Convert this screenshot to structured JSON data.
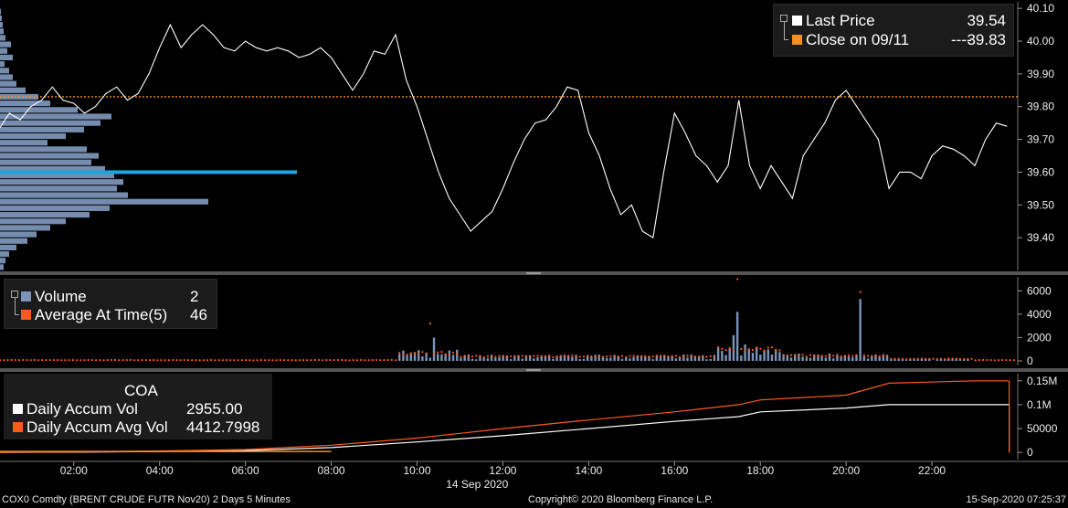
{
  "chart_data": [
    {
      "type": "line",
      "panel": "price",
      "series": [
        {
          "name": "Last Price",
          "color": "#ffffff",
          "values": [
            [
              0.0,
              39.62
            ],
            [
              0.25,
              39.73
            ],
            [
              0.5,
              39.78
            ],
            [
              0.75,
              39.76
            ],
            [
              1.0,
              39.8
            ],
            [
              1.25,
              39.82
            ],
            [
              1.5,
              39.86
            ],
            [
              1.75,
              39.82
            ],
            [
              2.0,
              39.81
            ],
            [
              2.25,
              39.78
            ],
            [
              2.5,
              39.8
            ],
            [
              2.75,
              39.84
            ],
            [
              3.0,
              39.86
            ],
            [
              3.25,
              39.82
            ],
            [
              3.5,
              39.84
            ],
            [
              3.75,
              39.9
            ],
            [
              4.0,
              39.98
            ],
            [
              4.25,
              40.05
            ],
            [
              4.5,
              39.98
            ],
            [
              4.75,
              40.02
            ],
            [
              5.0,
              40.05
            ],
            [
              5.25,
              40.02
            ],
            [
              5.5,
              39.98
            ],
            [
              5.75,
              39.97
            ],
            [
              6.0,
              40.0
            ],
            [
              6.25,
              39.98
            ],
            [
              6.5,
              39.97
            ],
            [
              6.75,
              39.98
            ],
            [
              7.0,
              39.97
            ],
            [
              7.25,
              39.95
            ],
            [
              7.5,
              39.96
            ],
            [
              7.75,
              39.98
            ],
            [
              8.0,
              39.95
            ],
            [
              8.25,
              39.9
            ],
            [
              8.5,
              39.85
            ],
            [
              8.75,
              39.9
            ],
            [
              9.0,
              39.97
            ],
            [
              9.25,
              39.96
            ],
            [
              9.5,
              40.02
            ],
            [
              9.75,
              39.88
            ],
            [
              10.0,
              39.8
            ],
            [
              10.25,
              39.7
            ],
            [
              10.5,
              39.6
            ],
            [
              10.75,
              39.52
            ],
            [
              11.0,
              39.47
            ],
            [
              11.25,
              39.42
            ],
            [
              11.5,
              39.45
            ],
            [
              11.75,
              39.48
            ],
            [
              12.0,
              39.55
            ],
            [
              12.25,
              39.63
            ],
            [
              12.5,
              39.7
            ],
            [
              12.75,
              39.75
            ],
            [
              13.0,
              39.76
            ],
            [
              13.25,
              39.8
            ],
            [
              13.5,
              39.86
            ],
            [
              13.75,
              39.85
            ],
            [
              14.0,
              39.72
            ],
            [
              14.25,
              39.65
            ],
            [
              14.5,
              39.55
            ],
            [
              14.75,
              39.47
            ],
            [
              15.0,
              39.5
            ],
            [
              15.25,
              39.42
            ],
            [
              15.5,
              39.4
            ],
            [
              15.75,
              39.6
            ],
            [
              16.0,
              39.78
            ],
            [
              16.25,
              39.72
            ],
            [
              16.5,
              39.65
            ],
            [
              16.75,
              39.62
            ],
            [
              17.0,
              39.57
            ],
            [
              17.25,
              39.62
            ],
            [
              17.5,
              39.82
            ],
            [
              17.75,
              39.62
            ],
            [
              18.0,
              39.55
            ],
            [
              18.25,
              39.62
            ],
            [
              18.5,
              39.57
            ],
            [
              18.75,
              39.52
            ],
            [
              19.0,
              39.65
            ],
            [
              19.25,
              39.7
            ],
            [
              19.5,
              39.75
            ],
            [
              19.75,
              39.82
            ],
            [
              20.0,
              39.85
            ],
            [
              20.25,
              39.8
            ],
            [
              20.5,
              39.75
            ],
            [
              20.75,
              39.7
            ],
            [
              21.0,
              39.55
            ],
            [
              21.25,
              39.6
            ],
            [
              21.5,
              39.6
            ],
            [
              21.75,
              39.58
            ],
            [
              22.0,
              39.65
            ],
            [
              22.25,
              39.68
            ],
            [
              22.5,
              39.67
            ],
            [
              22.75,
              39.65
            ],
            [
              23.0,
              39.62
            ],
            [
              23.25,
              39.7
            ],
            [
              23.5,
              39.75
            ],
            [
              23.75,
              39.74
            ]
          ]
        },
        {
          "name": "Close on 09/11",
          "color": "#f5911e",
          "constant": 39.83
        }
      ],
      "volume_profile": [
        [
          40.09,
          1
        ],
        [
          40.07,
          2
        ],
        [
          40.05,
          3
        ],
        [
          40.03,
          4
        ],
        [
          40.01,
          6
        ],
        [
          39.99,
          12
        ],
        [
          39.97,
          8
        ],
        [
          39.95,
          14
        ],
        [
          39.93,
          5
        ],
        [
          39.91,
          10
        ],
        [
          39.89,
          14
        ],
        [
          39.87,
          18
        ],
        [
          39.85,
          28
        ],
        [
          39.83,
          42
        ],
        [
          39.81,
          55
        ],
        [
          39.79,
          85
        ],
        [
          39.77,
          122
        ],
        [
          39.75,
          110
        ],
        [
          39.73,
          92
        ],
        [
          39.71,
          72
        ],
        [
          39.69,
          52
        ],
        [
          39.67,
          95
        ],
        [
          39.65,
          108
        ],
        [
          39.63,
          100
        ],
        [
          39.61,
          115
        ],
        [
          39.59,
          125
        ],
        [
          39.57,
          135
        ],
        [
          39.55,
          128
        ],
        [
          39.53,
          140
        ],
        [
          39.51,
          228
        ],
        [
          39.49,
          120
        ],
        [
          39.47,
          98
        ],
        [
          39.45,
          72
        ],
        [
          39.43,
          55
        ],
        [
          39.41,
          40
        ],
        [
          39.39,
          30
        ],
        [
          39.37,
          18
        ],
        [
          39.35,
          10
        ],
        [
          39.33,
          6
        ],
        [
          39.31,
          4
        ]
      ],
      "profile_max_level": 39.6,
      "ylim": [
        39.3,
        40.12
      ],
      "yticks": [
        "39.40",
        "39.50",
        "39.60",
        "39.70",
        "39.80",
        "39.90",
        "40.00",
        "40.10"
      ]
    },
    {
      "type": "bar",
      "panel": "volume",
      "series": [
        {
          "name": "Volume",
          "color": "#7b94b8"
        },
        {
          "name": "Average At Time(5)",
          "color": "#ff5a1e"
        }
      ],
      "ylim": [
        0,
        7200
      ],
      "yticks": [
        "0",
        "2000",
        "4000",
        "6000"
      ]
    },
    {
      "type": "line",
      "panel": "accumulated volume",
      "title": "COA",
      "series": [
        {
          "name": "Daily Accum Vol",
          "color": "#ffffff",
          "values": [
            [
              0,
              0
            ],
            [
              2,
              500
            ],
            [
              4,
              2000
            ],
            [
              6,
              4000
            ],
            [
              8,
              10000
            ],
            [
              10,
              22000
            ],
            [
              12,
              35000
            ],
            [
              14,
              50000
            ],
            [
              16,
              65000
            ],
            [
              17.5,
              75000
            ],
            [
              18,
              85000
            ],
            [
              20,
              93000
            ],
            [
              21,
              100000
            ],
            [
              23,
              100000
            ],
            [
              23.8,
              100000
            ]
          ]
        },
        {
          "name": "Daily Accum Avg Vol",
          "color": "#ff5a1e",
          "values": [
            [
              0,
              0
            ],
            [
              2,
              1000
            ],
            [
              4,
              3000
            ],
            [
              6,
              6000
            ],
            [
              8,
              15000
            ],
            [
              10,
              30000
            ],
            [
              12,
              50000
            ],
            [
              14,
              68000
            ],
            [
              16,
              85000
            ],
            [
              17.5,
              100000
            ],
            [
              18,
              110000
            ],
            [
              20,
              120000
            ],
            [
              21,
              145000
            ],
            [
              23,
              150000
            ],
            [
              23.8,
              150000
            ]
          ]
        }
      ],
      "ylim": [
        -15000,
        165000
      ],
      "yticks": [
        "0",
        "50000",
        "0.1M",
        "0.15M"
      ]
    }
  ],
  "x_axis": {
    "ticks": [
      "02:00",
      "04:00",
      "06:00",
      "08:00",
      "10:00",
      "12:00",
      "14:00",
      "16:00",
      "18:00",
      "20:00",
      "22:00"
    ],
    "date_label": "14 Sep 2020"
  },
  "legend_price": {
    "last_price_label": "Last Price",
    "last_price_value": "39.54",
    "close_label": "Close on 09/11",
    "close_dashes": "----",
    "close_value": "39.83"
  },
  "legend_volume": {
    "volume_label": "Volume",
    "volume_value": "2",
    "avg_label": "Average At Time(5)",
    "avg_value": "46"
  },
  "legend_accum": {
    "title": "COA",
    "accum_label": "Daily Accum Vol",
    "accum_value": "2955.00",
    "avg_label": "Daily Accum Avg Vol",
    "avg_value": "4412.7998"
  },
  "footer": {
    "security": "COX0 Comdty (BRENT CRUDE FUTR  Nov20) 2 Days 5 Minutes",
    "copyright": "Copyright© 2020 Bloomberg Finance L.P.",
    "timestamp": "15-Sep-2020  07:25:37"
  }
}
